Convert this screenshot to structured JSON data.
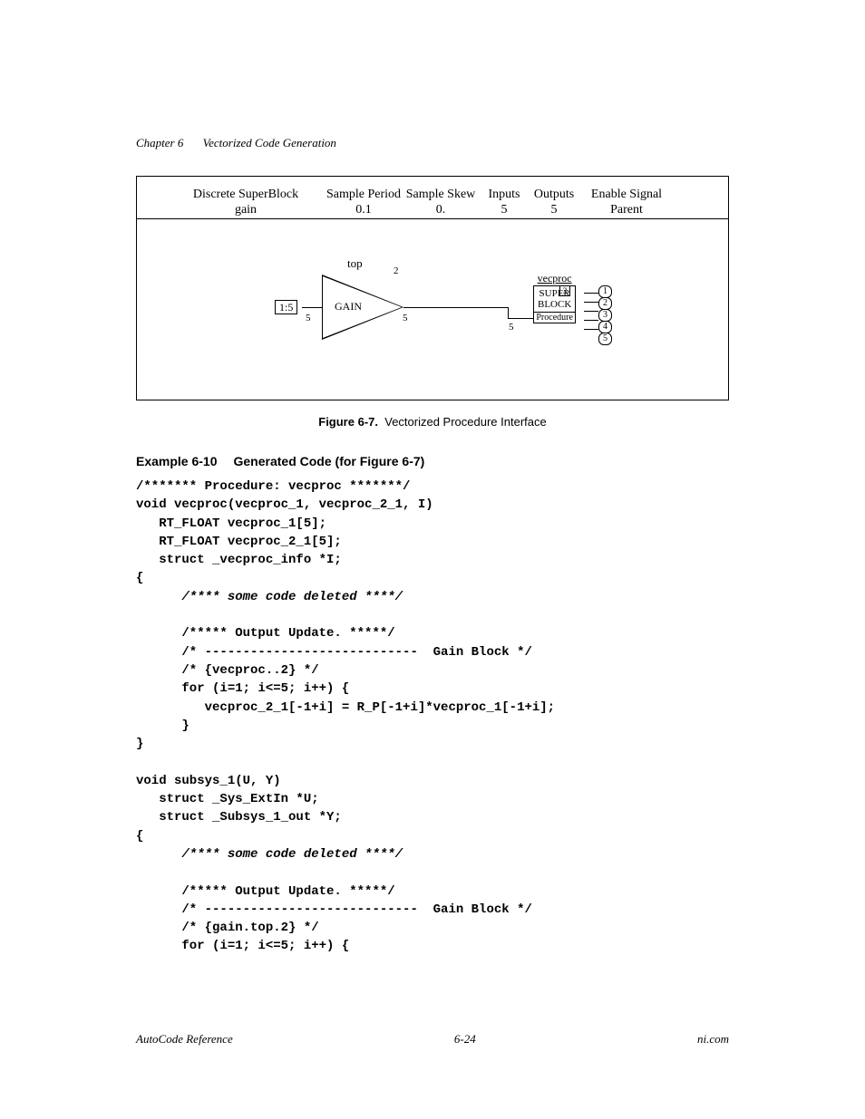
{
  "header": {
    "chapter": "Chapter 6",
    "title": "Vectorized Code Generation"
  },
  "figure": {
    "cols": {
      "c1_top": "Discrete SuperBlock",
      "c1_bot": "gain",
      "c2_top": "Sample Period",
      "c2_bot": "0.1",
      "c3_top": "Sample Skew",
      "c3_bot": "0.",
      "c4_top": "Inputs",
      "c4_bot": "5",
      "c5_top": "Outputs",
      "c5_bot": "5",
      "c6_top": "Enable Signal",
      "c6_bot": "Parent"
    },
    "diagram": {
      "top_label": "top",
      "input_range": "1:5",
      "gain_label": "GAIN",
      "idx2": "2",
      "signal5a": "5",
      "signal5b": "5",
      "signal5c": "5",
      "vecproc_label": "vecproc",
      "sb_line1": "SUPER",
      "sb_line2": "BLOCK",
      "sb_line3": "Procedure",
      "sb_idx": "3",
      "out1": "1",
      "out2": "2",
      "out3": "3",
      "out4": "4",
      "out5": "5"
    },
    "caption_bold": "Figure 6-7.",
    "caption_rest": "Vectorized Procedure Interface"
  },
  "example": {
    "label": "Example 6-10",
    "title": "Generated Code (for Figure 6-7)"
  },
  "code": {
    "l01": "/******* Procedure: vecproc *******/",
    "l02": "void vecproc(vecproc_1, vecproc_2_1, I)",
    "l03": "   RT_FLOAT vecproc_1[5];",
    "l04": "   RT_FLOAT vecproc_2_1[5];",
    "l05": "   struct _vecproc_info *I;",
    "l06": "{",
    "l07": "      /**** some code deleted ****/",
    "l08": "      /***** Output Update. *****/",
    "l09": "      /* ----------------------------  Gain Block */",
    "l10": "      /* {vecproc..2} */",
    "l11": "      for (i=1; i<=5; i++) {",
    "l12": "         vecproc_2_1[-1+i] = R_P[-1+i]*vecproc_1[-1+i];",
    "l13": "      }",
    "l14": "}",
    "l15": "void subsys_1(U, Y)",
    "l16": "   struct _Sys_ExtIn *U;",
    "l17": "   struct _Subsys_1_out *Y;",
    "l18": "{",
    "l19": "      /**** some code deleted ****/",
    "l20": "      /***** Output Update. *****/",
    "l21": "      /* ----------------------------  Gain Block */",
    "l22": "      /* {gain.top.2} */",
    "l23": "      for (i=1; i<=5; i++) {"
  },
  "footer": {
    "left": "AutoCode Reference",
    "center": "6-24",
    "right": "ni.com"
  }
}
